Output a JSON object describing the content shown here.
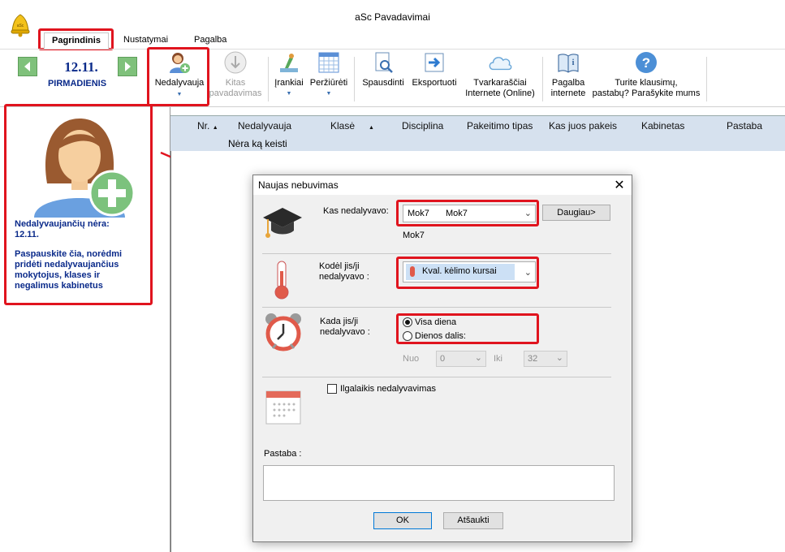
{
  "app": {
    "title": "aSc Pavadavimai"
  },
  "menu": {
    "tabs": [
      "Pagrindinis",
      "Nustatymai",
      "Pagalba"
    ]
  },
  "date": {
    "day": "12.11.",
    "weekday": "PIRMADIENIS"
  },
  "ribbon": {
    "absent": "Nedalyvauja",
    "other_line1": "Kitas",
    "other_line2": "pavadavimas",
    "tools": "Įrankiai",
    "view": "Peržiūrėti",
    "print": "Spausdinti",
    "export": "Eksportuoti",
    "online_line1": "Tvarkaraščiai",
    "online_line2": "Internete (Online)",
    "help_line1": "Pagalba",
    "help_line2": "internete",
    "questions_line1": "Turite klausimų,",
    "questions_line2": "pastabų? Parašykite mums"
  },
  "left_panel": {
    "no_absent": "Nedalyvaujančių nėra:",
    "date": "12.11.",
    "hint": "Paspauskite čia, norėdmi pridėti nedalyvaujančius mokytojus, klases ir negalimus kabinetus"
  },
  "grid": {
    "columns": [
      "Nr.",
      "Nedalyvauja",
      "Klasė",
      "Disciplina",
      "Pakeitimo tipas",
      "Kas juos pakeis",
      "Kabinetas",
      "Pastaba"
    ],
    "empty": "Nėra ką keisti"
  },
  "dialog": {
    "title": "Naujas nebuvimas",
    "who_label": "Kas nedalyvavo:",
    "who_value_a": "Mok7",
    "who_value_b": "Mok7",
    "who_sub": "Mok7",
    "more_button": "Daugiau>",
    "why_label_1": "Kodėl jis/ji",
    "why_label_2": "nedalyvavo :",
    "why_value": "Kval. kėlimo kursai",
    "when_label_1": "Kada jis/ji",
    "when_label_2": "nedalyvavo :",
    "whole_day": "Visa diena",
    "part_day": "Dienos dalis:",
    "from_label": "Nuo",
    "from_value": "0",
    "to_label": "Iki",
    "to_value": "32",
    "long_term": "Ilgalaikis nedalyvavimas",
    "note_label": "Pastaba :",
    "ok": "OK",
    "cancel": "Atšaukti"
  },
  "colors": {
    "highlight_red": "#e0141e",
    "grid_header": "#d6e1ee",
    "accent_blue": "#0a2a8a"
  }
}
